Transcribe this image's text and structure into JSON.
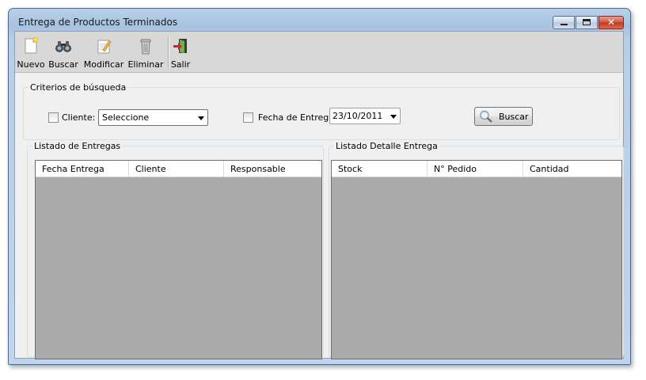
{
  "window": {
    "title": "Entrega de Productos Terminados",
    "close_glyph": "✕"
  },
  "toolbar": {
    "items": [
      {
        "label": "Nuevo",
        "icon": "new-document-icon"
      },
      {
        "label": "Buscar",
        "icon": "binoculars-icon"
      },
      {
        "label": "Modificar",
        "icon": "edit-icon"
      },
      {
        "label": "Eliminar",
        "icon": "trash-icon"
      },
      {
        "label": "Salir",
        "icon": "exit-door-icon"
      }
    ]
  },
  "search": {
    "legend": "Criterios de búsqueda",
    "client_label": "Cliente:",
    "client_value": "Seleccione",
    "date_label": "Fecha de Entrega:",
    "date_value": "23/10/2011",
    "button_label": "Buscar"
  },
  "deliveries": {
    "legend": "Listado de Entregas",
    "columns": [
      "Fecha Entrega",
      "Cliente",
      "Responsable"
    ]
  },
  "details": {
    "legend": "Listado Detalle Entrega",
    "columns": [
      "Stock",
      "N° Pedido",
      "Cantidad"
    ]
  },
  "colors": {
    "grid_background": "#ababab",
    "toolbar_background": "#d8d8d8",
    "window_frame": "#b9cde4"
  }
}
